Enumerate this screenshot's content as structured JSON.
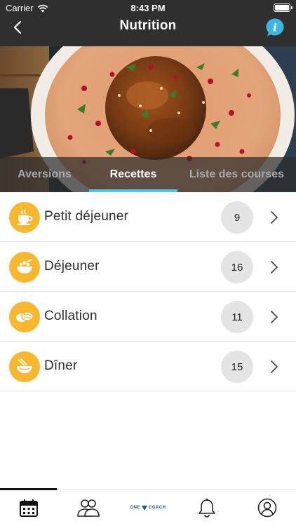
{
  "status_bar": {
    "carrier": "Carrier",
    "time": "8:43 PM"
  },
  "nav": {
    "title": "Nutrition",
    "info_glyph": "i"
  },
  "tabs": [
    {
      "label": "Aversions",
      "active": false
    },
    {
      "label": "Recettes",
      "active": true
    },
    {
      "label": "Liste des courses",
      "active": false
    }
  ],
  "meals": [
    {
      "label": "Petit déjeuner",
      "count": "9",
      "icon": "coffee-cup-icon"
    },
    {
      "label": "Déjeuner",
      "count": "16",
      "icon": "salad-bowl-icon"
    },
    {
      "label": "Collation",
      "count": "11",
      "icon": "snack-icon"
    },
    {
      "label": "Dîner",
      "count": "15",
      "icon": "noodle-bowl-icon"
    }
  ],
  "bottom_tabs": [
    {
      "name": "calendar-icon",
      "active": true
    },
    {
      "name": "community-icon",
      "active": false
    },
    {
      "name": "onecoach-logo",
      "active": false
    },
    {
      "name": "bell-icon",
      "active": false
    },
    {
      "name": "profile-icon",
      "active": false
    }
  ],
  "brand": {
    "left": "ONE",
    "right": "COACH"
  },
  "colors": {
    "accent": "#4ec6e6",
    "meal_icon_bg": "#f7b731",
    "header_bg": "#2f2f2f",
    "count_bg": "#e4e4e4",
    "info_button": "#3fb6e0"
  }
}
